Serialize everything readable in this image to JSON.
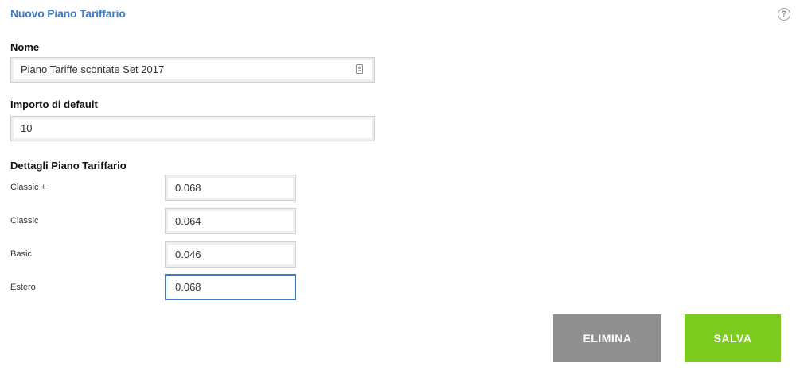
{
  "header": {
    "title": "Nuovo Piano Tariffario",
    "help_icon_glyph": "?"
  },
  "form": {
    "name_label": "Nome",
    "name_value": "Piano Tariffe scontate Set 2017",
    "name_icon": "contact-card-icon",
    "default_amount_label": "Importo di default",
    "default_amount_value": "10",
    "details_label": "Dettagli Piano Tariffario",
    "rates": [
      {
        "label": "Classic +",
        "value": "0.068"
      },
      {
        "label": "Classic",
        "value": "0.064"
      },
      {
        "label": "Basic",
        "value": "0.046"
      },
      {
        "label": "Estero",
        "value": "0.068"
      }
    ]
  },
  "actions": {
    "delete_label": "ELIMINA",
    "save_label": "SALVA"
  },
  "colors": {
    "title": "#3d7cc9",
    "focus_border": "#3f79c2",
    "delete_button": "#8f8f8f",
    "save_button": "#7ccb1e"
  }
}
